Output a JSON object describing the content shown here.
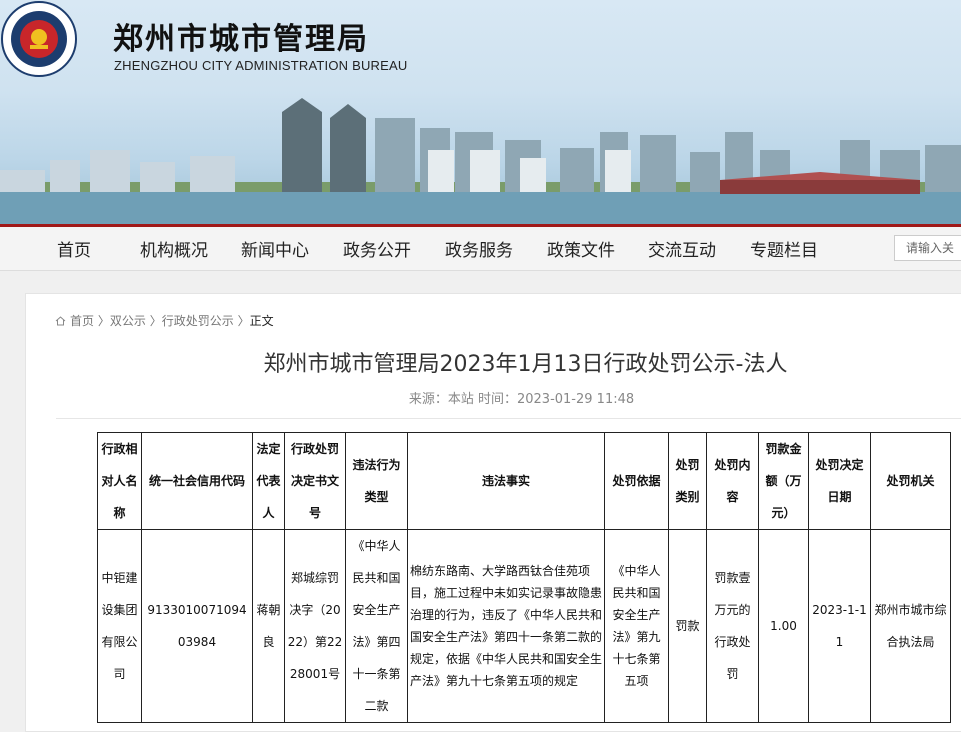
{
  "header": {
    "title": "郑州市城市管理局",
    "subtitle": "ZHENGZHOU CITY ADMINISTRATION BUREAU"
  },
  "nav": {
    "items": [
      "首页",
      "机构概况",
      "新闻中心",
      "政务公开",
      "政务服务",
      "政策文件",
      "交流互动",
      "专题栏目"
    ],
    "search_placeholder": "请输入关"
  },
  "breadcrumb": [
    "首页",
    "双公示",
    "行政处罚公示",
    "正文"
  ],
  "article": {
    "title": "郑州市城市管理局2023年1月13日行政处罚公示-法人",
    "meta": "来源：本站  时间：2023-01-29 11:48"
  },
  "table": {
    "headers": [
      "行政相对人名称",
      "统一社会信用代码",
      "法定代表人",
      "行政处罚决定书文号",
      "违法行为类型",
      "违法事实",
      "处罚依据",
      "处罚类别",
      "处罚内容",
      "罚款金额（万元）",
      "处罚决定日期",
      "处罚机关"
    ],
    "rows": [
      [
        "中钜建设集团有限公司",
        "91330100710940398​4",
        "蒋朝良",
        "郑城综罚决字（2022）第2228001号",
        "《中华人民共和国安全生产法》第四十一条第二款",
        "棉纺东路南、大学路西钛合佳苑项目，施工过程中未如实记录事故隐患治理的行为，违反了《中华人民共和国安全生产法》第四十一条第二款的规定，依据《中华人民共和国安全生产法》第九十七条第五项的规定",
        "《中华人民共和国安全生产法》第九十七条第五项",
        "罚款",
        "罚款壹万元的行政处罚",
        "1.00",
        "2023-1-11",
        "郑州市城市综合执法局"
      ]
    ]
  },
  "colors": {
    "accent": "#a01818",
    "nav_bg": "#f4f4f4"
  }
}
